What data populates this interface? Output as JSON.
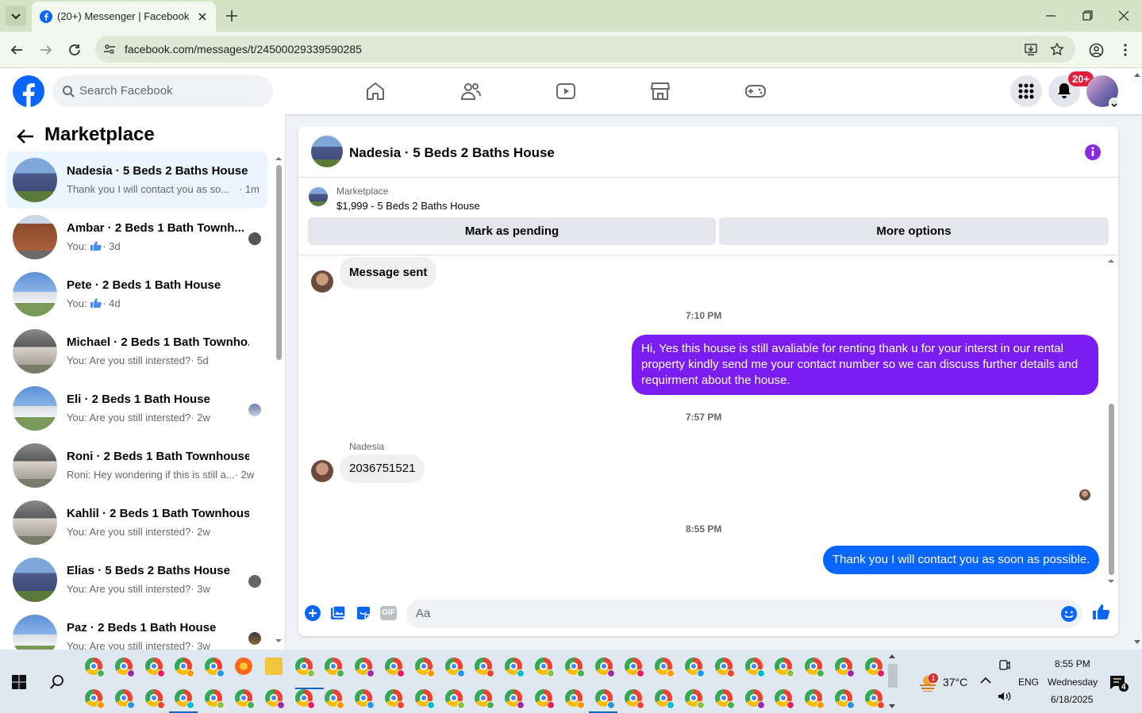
{
  "browser": {
    "tab_title": "(20+) Messenger | Facebook",
    "url": "facebook.com/messages/t/24500029339590285"
  },
  "header": {
    "search_placeholder": "Search Facebook",
    "notification_badge": "20+"
  },
  "sidebar": {
    "title": "Marketplace",
    "conversations": [
      {
        "name": "Nadesia · 5 Beds 2 Baths House",
        "preview": "Thank you I will contact you as so...",
        "time": "· 1m",
        "active": true
      },
      {
        "name": "Ambar · 2 Beds 1 Bath Townh...",
        "preview": "You:",
        "time": "· 3d"
      },
      {
        "name": "Pete · 2 Beds 1 Bath House",
        "preview": "You:",
        "time": "· 4d"
      },
      {
        "name": "Michael · 2 Beds 1 Bath Townho...",
        "preview": "You: Are you still intersted?",
        "time": "· 5d"
      },
      {
        "name": "Eli · 2 Beds 1 Bath House",
        "preview": "You: Are you still intersted?",
        "time": "· 2w"
      },
      {
        "name": "Roni · 2 Beds 1 Bath Townhouse",
        "preview": "Roni: Hey wondering if this is still a...",
        "time": "· 2w"
      },
      {
        "name": "Kahlil · 2 Beds 1 Bath Townhouse",
        "preview": "You: Are you still intersted?",
        "time": "· 2w"
      },
      {
        "name": "Elias · 5 Beds 2 Baths House",
        "preview": "You: Are you still intersted?",
        "time": "· 3w"
      },
      {
        "name": "Paz · 2 Beds 1 Bath House",
        "preview": "You: Are you still intersted?",
        "time": "· 3w"
      }
    ]
  },
  "chat": {
    "title": "Nadesia · 5 Beds 2 Baths House",
    "listing_label": "Marketplace",
    "listing_price": "$1,999 - 5 Beds 2 Baths House",
    "mark_pending": "Mark as pending",
    "more_options": "More options",
    "messages": [
      {
        "text": "Message sent"
      },
      {
        "time": "7:10 PM"
      },
      {
        "text": "Hi, Yes this house is still avaliable for renting thank u for your interst in our rental property kindly send me your contact number so we can discuss further details and requirment about the house."
      },
      {
        "time": "7:57 PM"
      },
      {
        "sender": "Nadesia",
        "text": "2036751521"
      },
      {
        "time": "8:55 PM"
      },
      {
        "text": "Thank you I will contact  you as soon as possible."
      }
    ],
    "input_placeholder": "Aa",
    "gif_label": "GIF"
  },
  "taskbar": {
    "weather": "37°C",
    "weather_badge": "1",
    "language": "ENG",
    "time": "8:55 PM",
    "day": "Wednesday",
    "date": "6/18/2025",
    "notif_count": "4"
  },
  "colors": {
    "fb_blue": "#0866ff",
    "purple": "#8a2be2",
    "bubble_purple": "#7a1cf2",
    "badge_red": "#e41e3f"
  }
}
